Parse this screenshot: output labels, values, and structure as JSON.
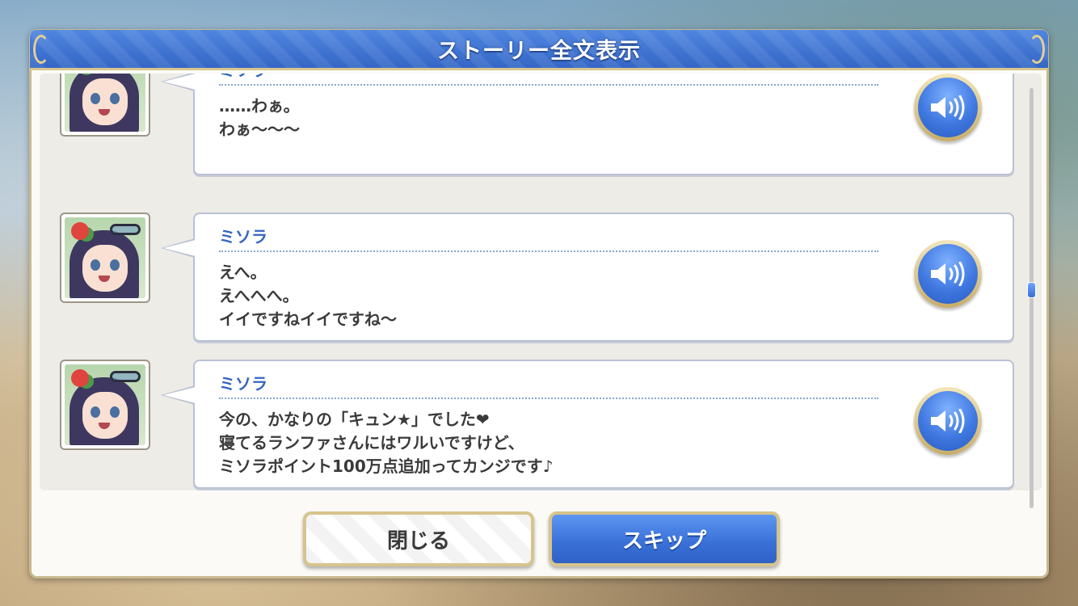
{
  "dialog": {
    "title": "ストーリー全文表示"
  },
  "entries": [
    {
      "speaker": "ミソラ",
      "lines": [
        "……わぁ。",
        "わぁ〜〜〜"
      ]
    },
    {
      "speaker": "ミソラ",
      "lines": [
        "えへ。",
        "えへへへ。",
        "イイですねイイですね〜"
      ]
    },
    {
      "speaker": "ミソラ",
      "lines": [
        "今の、かなりの「キュン★」でした❤",
        "寝てるランファさんにはワルいですけど、",
        "ミソラポイント100万点追加ってカンジです♪"
      ]
    }
  ],
  "icons": {
    "voice": "speaker-volume-icon",
    "avatar": "character-portrait"
  },
  "colors": {
    "title_bar": "#3f74d4",
    "speaker_name": "#3565c0",
    "frame_gold": "#d6c48c",
    "skip_button": "#3b72d9"
  },
  "buttons": {
    "close_label": "閉じる",
    "skip_label": "スキップ"
  }
}
